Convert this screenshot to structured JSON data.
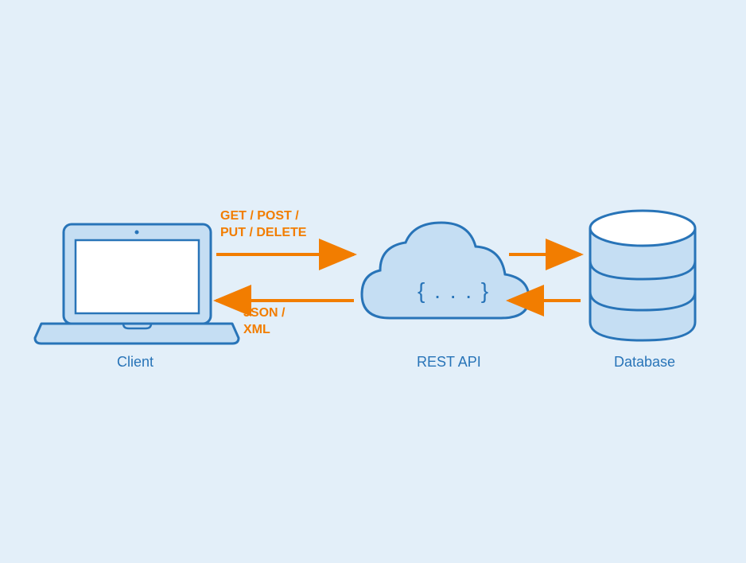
{
  "nodes": {
    "client": {
      "label": "Client"
    },
    "api": {
      "label": "REST API",
      "inner_text": "{ . . . }"
    },
    "database": {
      "label": "Database"
    }
  },
  "arrows": {
    "request_label_line1": "GET / POST /",
    "request_label_line2": "PUT / DELETE",
    "response_label_line1": "JSON /",
    "response_label_line2": "XML"
  },
  "colors": {
    "bg": "#e3eff9",
    "stroke": "#2874b8",
    "fill_light": "#c5def3",
    "fill_white": "#ffffff",
    "arrow": "#f27d00"
  }
}
